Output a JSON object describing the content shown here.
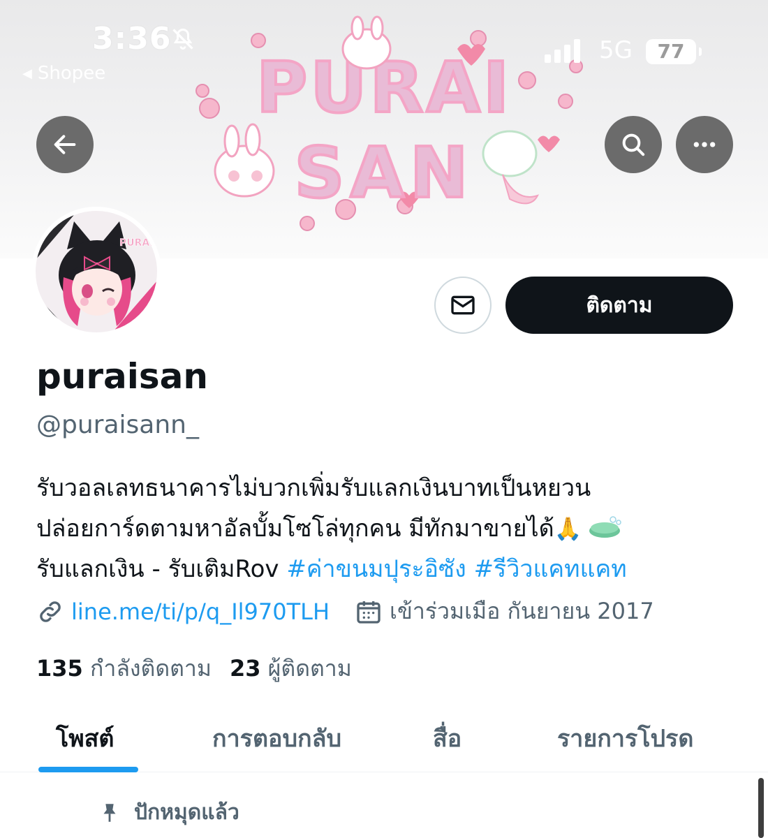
{
  "status_bar": {
    "time": "3:36",
    "back_app": "Shopee",
    "network": "5G",
    "battery": "77"
  },
  "banner": {
    "title_line1": "PURAI",
    "title_line2": "SAN",
    "colors": {
      "title": "#e8b7d4",
      "outline": "#f3a9c9",
      "accent": "#b7a8e6"
    }
  },
  "avatar": {
    "badge_text": "PURAI SAN"
  },
  "actions": {
    "follow_label": "ติดตาม"
  },
  "profile": {
    "display_name": "puraisan",
    "handle": "@puraisann_",
    "bio_line1": "รับวอลเลทธนาคารไม่บวกเพิ่มรับแลกเงินบาทเป็นหยวน",
    "bio_line2": "ปล่อยการ์ดตามหาอัลบั้มโซโล่ทุกคน มีทักมาขายได้",
    "bio_line2_emoji": "🙏",
    "bio_line3_text": "รับแลกเงิน - รับเติมRov ",
    "hashtag1": "#ค่าขนมปุระอิซัง",
    "hashtag2": "#รีวิวแคทแคท",
    "link": "line.me/ti/p/q_Il970TLH",
    "joined": "เข้าร่วมเมือ กันยายน 2017",
    "following_count": "135",
    "following_label": "กำลังติดตาม",
    "followers_count": "23",
    "followers_label": "ผู้ติดตาม"
  },
  "tabs": [
    {
      "label": "โพสต์",
      "active": true
    },
    {
      "label": "การตอบกลับ",
      "active": false
    },
    {
      "label": "สื่อ",
      "active": false
    },
    {
      "label": "รายการโปรด",
      "active": false
    }
  ],
  "pinned": {
    "label": "ปักหมุดแล้ว"
  },
  "icons": {
    "back": "arrow-left-icon",
    "search": "search-icon",
    "more": "more-icon",
    "mail": "mail-icon",
    "link": "link-icon",
    "calendar": "calendar-icon",
    "pin": "pin-icon"
  },
  "theme": {
    "accent": "#1d9bf0",
    "text": "#0f1419",
    "muted": "#536471"
  }
}
